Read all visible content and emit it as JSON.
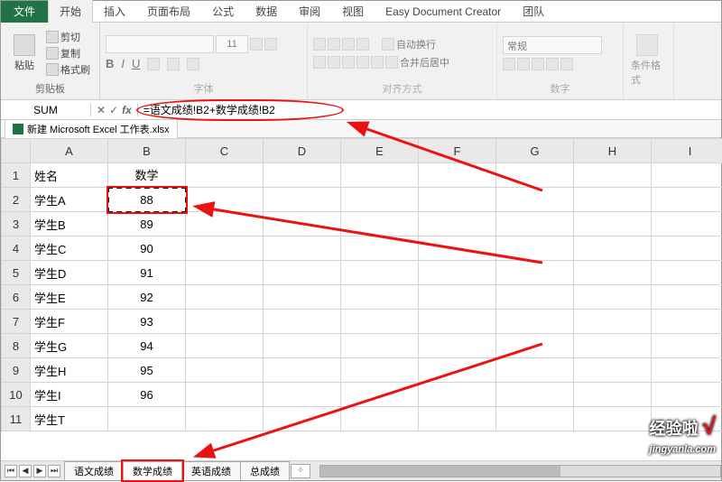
{
  "tabs": {
    "file": "文件",
    "items": [
      "开始",
      "插入",
      "页面布局",
      "公式",
      "数据",
      "审阅",
      "视图",
      "Easy Document Creator",
      "团队"
    ],
    "active": 0
  },
  "ribbon": {
    "clipboard": {
      "label": "剪贴板",
      "paste": "粘贴",
      "cut": "剪切",
      "copy": "复制",
      "format_painter": "格式刷"
    },
    "font": {
      "label": "字体",
      "size": "11",
      "bold": "B",
      "italic": "I",
      "underline": "U"
    },
    "alignment": {
      "label": "对齐方式",
      "wrap": "自动换行",
      "merge": "合并后居中"
    },
    "number": {
      "label": "数字",
      "format": "常规"
    },
    "cellfmt": {
      "label": "条件格式"
    }
  },
  "formula_bar": {
    "name_box": "SUM",
    "cancel": "✕",
    "enter": "✓",
    "fx": "fx",
    "formula": "=语文成绩!B2+数学成绩!B2"
  },
  "workbook_file": "新建 Microsoft Excel 工作表.xlsx",
  "columns": [
    "A",
    "B",
    "C",
    "D",
    "E",
    "F",
    "G",
    "H",
    "I"
  ],
  "rows": [
    {
      "n": 1,
      "a": "姓名",
      "b": "数学"
    },
    {
      "n": 2,
      "a": "学生A",
      "b": "88"
    },
    {
      "n": 3,
      "a": "学生B",
      "b": "89"
    },
    {
      "n": 4,
      "a": "学生C",
      "b": "90"
    },
    {
      "n": 5,
      "a": "学生D",
      "b": "91"
    },
    {
      "n": 6,
      "a": "学生E",
      "b": "92"
    },
    {
      "n": 7,
      "a": "学生F",
      "b": "93"
    },
    {
      "n": 8,
      "a": "学生G",
      "b": "94"
    },
    {
      "n": 9,
      "a": "学生H",
      "b": "95"
    },
    {
      "n": 10,
      "a": "学生I",
      "b": "96"
    },
    {
      "n": 11,
      "a": "学生T",
      "b": ""
    }
  ],
  "sheets": {
    "items": [
      "语文成绩",
      "数学成绩",
      "英语成绩",
      "总成绩"
    ],
    "active": 1
  },
  "watermark": {
    "brand": "经验啦",
    "check": "√",
    "url": "jingyanla.com"
  },
  "annotation_colors": {
    "highlight": "#e11111"
  }
}
